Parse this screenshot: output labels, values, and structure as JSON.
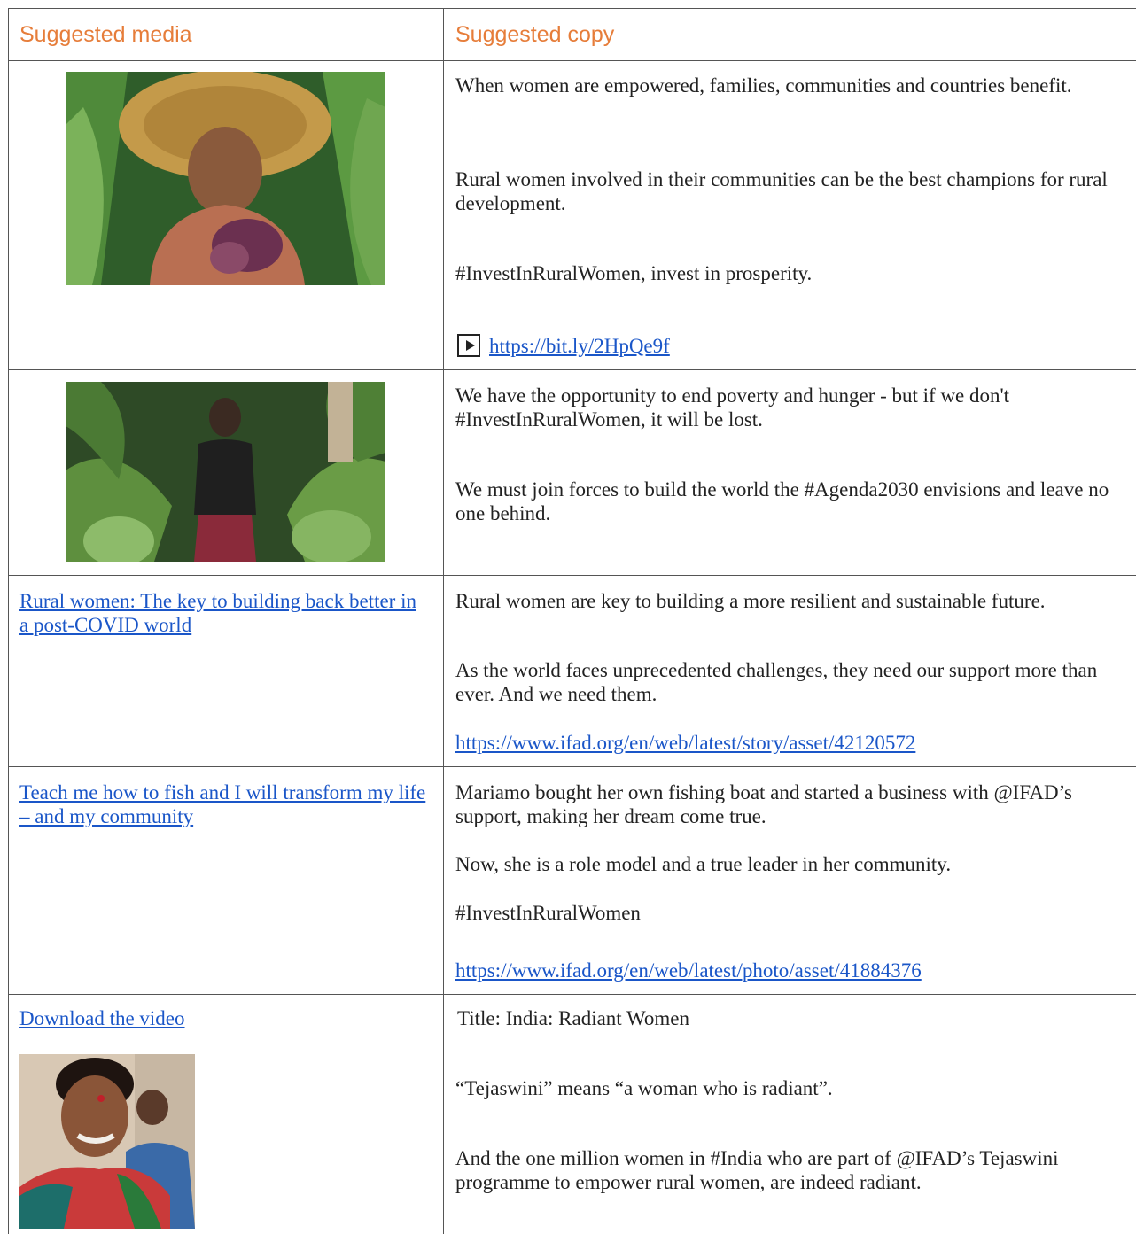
{
  "header": {
    "media_label": "Suggested media",
    "copy_label": "Suggested copy"
  },
  "rows": [
    {
      "media": {
        "type": "photo",
        "subject": "woman-straw-hat-photo"
      },
      "copy": [
        "When women are empowered, families, communities and countries benefit.",
        "Rural women involved in their communities can be the best champions for rural development.",
        "#InvestInRuralWomen, invest in prosperity."
      ],
      "link": "https://bit.ly/2HpQe9f",
      "link_icon": "video-play-icon"
    },
    {
      "media": {
        "type": "photo",
        "subject": "woman-banana-plantation-photo"
      },
      "copy": [
        "We have the opportunity to end poverty and hunger - but if we don't #InvestInRuralWomen, it will be lost.",
        "We must join forces to build the world the #Agenda2030 envisions and leave no one behind."
      ]
    },
    {
      "media": {
        "type": "link",
        "text": "Rural women: The key to building back better in a post-COVID world"
      },
      "copy": [
        "Rural women are key to building a more resilient and sustainable future.",
        "As the world faces unprecedented challenges, they need our support more than ever. And we need them."
      ],
      "link": "https://www.ifad.org/en/web/latest/story/asset/42120572"
    },
    {
      "media": {
        "type": "link",
        "text": "Teach me how to fish and I will transform my life – and my community"
      },
      "copy": [
        "Mariamo bought her own fishing boat and started a business with @IFAD’s support, making her dream come true.",
        "Now, she is a role model and a true leader in her community.",
        "#InvestInRuralWomen"
      ],
      "link": "https://www.ifad.org/en/web/latest/photo/asset/41884376"
    },
    {
      "media": {
        "type": "link+photo",
        "text": "Download the video",
        "subject": "smiling-woman-photo"
      },
      "copy": [
        "Title: India: Radiant Women",
        "“Tejaswini” means “a woman who is radiant”.",
        "And the one million women in #India who are part of @IFAD’s Tejaswini programme to empower rural women, are indeed radiant."
      ]
    }
  ],
  "colors": {
    "header": "#e67d3a",
    "link": "#1a56c8",
    "border": "#555555",
    "text": "#222222"
  }
}
